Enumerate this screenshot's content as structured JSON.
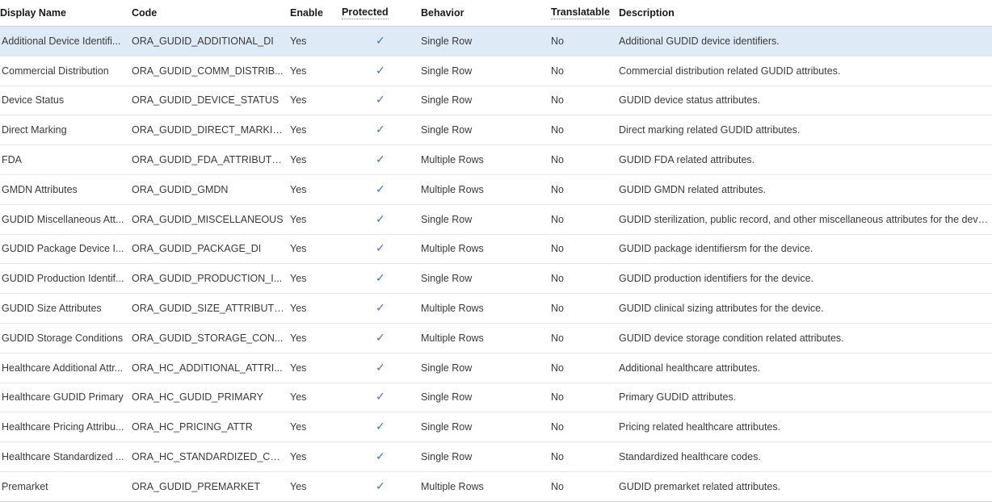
{
  "table": {
    "columns": [
      {
        "key": "display_name",
        "label": "Display Name",
        "sortable": false
      },
      {
        "key": "code",
        "label": "Code",
        "sortable": false
      },
      {
        "key": "enable",
        "label": "Enable",
        "sortable": false
      },
      {
        "key": "protected",
        "label": "Protected",
        "sortable": true
      },
      {
        "key": "behavior",
        "label": "Behavior",
        "sortable": false
      },
      {
        "key": "translatable",
        "label": "Translatable",
        "sortable": true
      },
      {
        "key": "description",
        "label": "Description",
        "sortable": false
      }
    ],
    "protected_check_glyph": "✓",
    "selected_row_index": 0,
    "colors": {
      "selected_row_background": "#dfeaf7",
      "check_mark": "#4a6fb5",
      "header_text": "#1a1a1a",
      "body_text": "#3a3a3a",
      "row_divider": "#e6e6e6",
      "header_divider": "#c9d4e2",
      "page_background": "#ffffff"
    },
    "rows": [
      {
        "display_name": "Additional Device Identifi...",
        "code": "ORA_GUDID_ADDITIONAL_DI",
        "enable": "Yes",
        "protected": true,
        "behavior": "Single Row",
        "translatable": "No",
        "description": "Additional GUDID device identifiers."
      },
      {
        "display_name": "Commercial Distribution",
        "code": "ORA_GUDID_COMM_DISTRIB...",
        "enable": "Yes",
        "protected": true,
        "behavior": "Single Row",
        "translatable": "No",
        "description": "Commercial distribution related GUDID attributes."
      },
      {
        "display_name": "Device Status",
        "code": "ORA_GUDID_DEVICE_STATUS",
        "enable": "Yes",
        "protected": true,
        "behavior": "Single Row",
        "translatable": "No",
        "description": "GUDID device status attributes."
      },
      {
        "display_name": "Direct Marking",
        "code": "ORA_GUDID_DIRECT_MARKING",
        "enable": "Yes",
        "protected": true,
        "behavior": "Single Row",
        "translatable": "No",
        "description": "Direct marking related GUDID attributes."
      },
      {
        "display_name": "FDA",
        "code": "ORA_GUDID_FDA_ATTRIBUTES",
        "enable": "Yes",
        "protected": true,
        "behavior": "Multiple Rows",
        "translatable": "No",
        "description": "GUDID FDA related attributes."
      },
      {
        "display_name": "GMDN Attributes",
        "code": "ORA_GUDID_GMDN",
        "enable": "Yes",
        "protected": true,
        "behavior": "Multiple Rows",
        "translatable": "No",
        "description": "GUDID GMDN related attributes."
      },
      {
        "display_name": "GUDID Miscellaneous Att...",
        "code": "ORA_GUDID_MISCELLANEOUS",
        "enable": "Yes",
        "protected": true,
        "behavior": "Single Row",
        "translatable": "No",
        "description": "GUDID sterilization, public record, and other miscellaneous attributes for the device."
      },
      {
        "display_name": "GUDID Package Device I...",
        "code": "ORA_GUDID_PACKAGE_DI",
        "enable": "Yes",
        "protected": true,
        "behavior": "Multiple Rows",
        "translatable": "No",
        "description": "GUDID package identifiersm for the device."
      },
      {
        "display_name": "GUDID Production Identif...",
        "code": "ORA_GUDID_PRODUCTION_I...",
        "enable": "Yes",
        "protected": true,
        "behavior": "Single Row",
        "translatable": "No",
        "description": "GUDID production identifiers for the device."
      },
      {
        "display_name": "GUDID Size Attributes",
        "code": "ORA_GUDID_SIZE_ATTRIBUTES",
        "enable": "Yes",
        "protected": true,
        "behavior": "Multiple Rows",
        "translatable": "No",
        "description": "GUDID clinical sizing attributes for the device."
      },
      {
        "display_name": "GUDID Storage Conditions",
        "code": "ORA_GUDID_STORAGE_CON...",
        "enable": "Yes",
        "protected": true,
        "behavior": "Multiple Rows",
        "translatable": "No",
        "description": "GUDID device storage condition related attributes."
      },
      {
        "display_name": "Healthcare Additional Attr...",
        "code": "ORA_HC_ADDITIONAL_ATTRI...",
        "enable": "Yes",
        "protected": true,
        "behavior": "Single Row",
        "translatable": "No",
        "description": "Additional healthcare attributes."
      },
      {
        "display_name": "Healthcare GUDID Primary",
        "code": "ORA_HC_GUDID_PRIMARY",
        "enable": "Yes",
        "protected": true,
        "behavior": "Single Row",
        "translatable": "No",
        "description": "Primary GUDID attributes."
      },
      {
        "display_name": "Healthcare Pricing Attribu...",
        "code": "ORA_HC_PRICING_ATTR",
        "enable": "Yes",
        "protected": true,
        "behavior": "Single Row",
        "translatable": "No",
        "description": "Pricing related healthcare attributes."
      },
      {
        "display_name": "Healthcare Standardized ...",
        "code": "ORA_HC_STANDARDIZED_CO...",
        "enable": "Yes",
        "protected": true,
        "behavior": "Single Row",
        "translatable": "No",
        "description": "Standardized healthcare codes."
      },
      {
        "display_name": "Premarket",
        "code": "ORA_GUDID_PREMARKET",
        "enable": "Yes",
        "protected": true,
        "behavior": "Multiple Rows",
        "translatable": "No",
        "description": "GUDID premarket related attributes."
      }
    ]
  }
}
